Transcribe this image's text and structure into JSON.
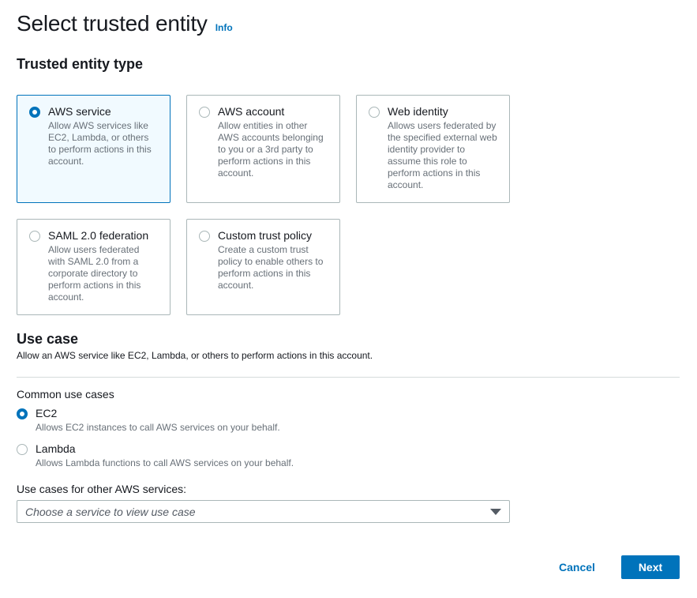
{
  "header": {
    "title": "Select trusted entity",
    "info": "Info"
  },
  "trusted_entity": {
    "title": "Trusted entity type",
    "tiles": [
      {
        "title": "AWS service",
        "desc": "Allow AWS services like EC2, Lambda, or others to perform actions in this account.",
        "selected": true
      },
      {
        "title": "AWS account",
        "desc": "Allow entities in other AWS accounts belonging to you or a 3rd party to perform actions in this account.",
        "selected": false
      },
      {
        "title": "Web identity",
        "desc": "Allows users federated by the specified external web identity provider to assume this role to perform actions in this account.",
        "selected": false
      },
      {
        "title": "SAML 2.0 federation",
        "desc": "Allow users federated with SAML 2.0 from a corporate directory to perform actions in this account.",
        "selected": false
      },
      {
        "title": "Custom trust policy",
        "desc": "Create a custom trust policy to enable others to perform actions in this account.",
        "selected": false
      }
    ]
  },
  "use_case": {
    "title": "Use case",
    "desc": "Allow an AWS service like EC2, Lambda, or others to perform actions in this account.",
    "common_label": "Common use cases",
    "options": [
      {
        "title": "EC2",
        "desc": "Allows EC2 instances to call AWS services on your behalf.",
        "selected": true
      },
      {
        "title": "Lambda",
        "desc": "Allows Lambda functions to call AWS services on your behalf.",
        "selected": false
      }
    ],
    "other_label": "Use cases for other AWS services:",
    "select_placeholder": "Choose a service to view use case"
  },
  "footer": {
    "cancel": "Cancel",
    "next": "Next"
  },
  "colors": {
    "accent": "#0073bb",
    "selected_bg": "#f1faff",
    "border": "#aab7b8",
    "muted_text": "#687078"
  }
}
